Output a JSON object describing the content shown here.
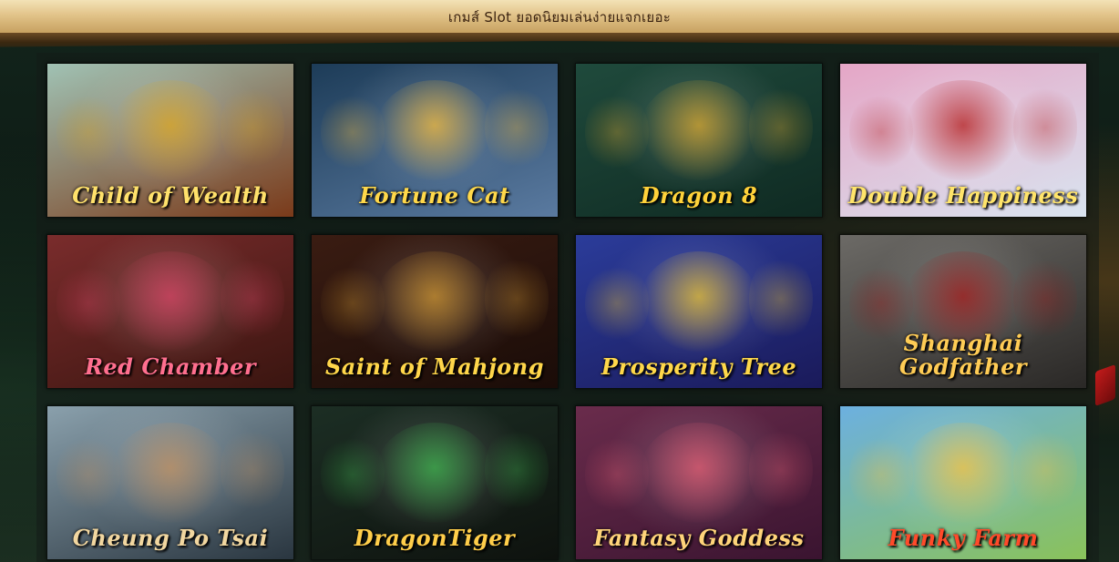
{
  "header": {
    "title": "เกมส์ Slot ยอดนิยมเล่นง่ายแจกเยอะ"
  },
  "games": [
    {
      "title": "Child of Wealth",
      "logo_color": "#ffe16b",
      "bg_from": "#a0c2b4",
      "bg_to": "#7a3a1a",
      "accent": "#d9a520"
    },
    {
      "title": "Fortune Cat",
      "logo_color": "#ffd84a",
      "bg_from": "#1d3c58",
      "bg_to": "#5a7aa0",
      "accent": "#f0b83a"
    },
    {
      "title": "Dragon 8",
      "logo_color": "#ffd23a",
      "bg_from": "#1f4a3c",
      "bg_to": "#0f2a22",
      "accent": "#d6a52c"
    },
    {
      "title": "Double Happiness",
      "logo_color": "#ffe46a",
      "bg_from": "#e5a6c6",
      "bg_to": "#d9e4f0",
      "accent": "#b21a1a"
    },
    {
      "title": "Red Chamber",
      "logo_color": "#ff6f8f",
      "bg_from": "#7a2c2c",
      "bg_to": "#3a1510",
      "accent": "#d34060"
    },
    {
      "title": "Saint of Mahjong",
      "logo_color": "#ffd64a",
      "bg_from": "#3a1c12",
      "bg_to": "#1a0c08",
      "accent": "#c9902c"
    },
    {
      "title": "Prosperity Tree",
      "logo_color": "#ffd84a",
      "bg_from": "#2b3c9a",
      "bg_to": "#1a1a5a",
      "accent": "#e8c030"
    },
    {
      "title": "Shanghai Godfather",
      "logo_color": "#ffcc55",
      "bg_from": "#6c6a66",
      "bg_to": "#2a2826",
      "accent": "#a01818"
    },
    {
      "title": "Cheung Po Tsai",
      "logo_color": "#f2d7a0",
      "bg_from": "#8aa0ac",
      "bg_to": "#2a3640",
      "accent": "#c09060"
    },
    {
      "title": "DragonTiger",
      "logo_color": "#ffce4a",
      "bg_from": "#1c2e24",
      "bg_to": "#0e120e",
      "accent": "#3ab04a"
    },
    {
      "title": "Fantasy Goddess",
      "logo_color": "#ffd47a",
      "bg_from": "#6a2c4c",
      "bg_to": "#3a1430",
      "accent": "#e05a70"
    },
    {
      "title": "Funky Farm",
      "logo_color": "#ff4a2a",
      "bg_from": "#6cb0e0",
      "bg_to": "#8ac25a",
      "accent": "#f0c040"
    }
  ]
}
